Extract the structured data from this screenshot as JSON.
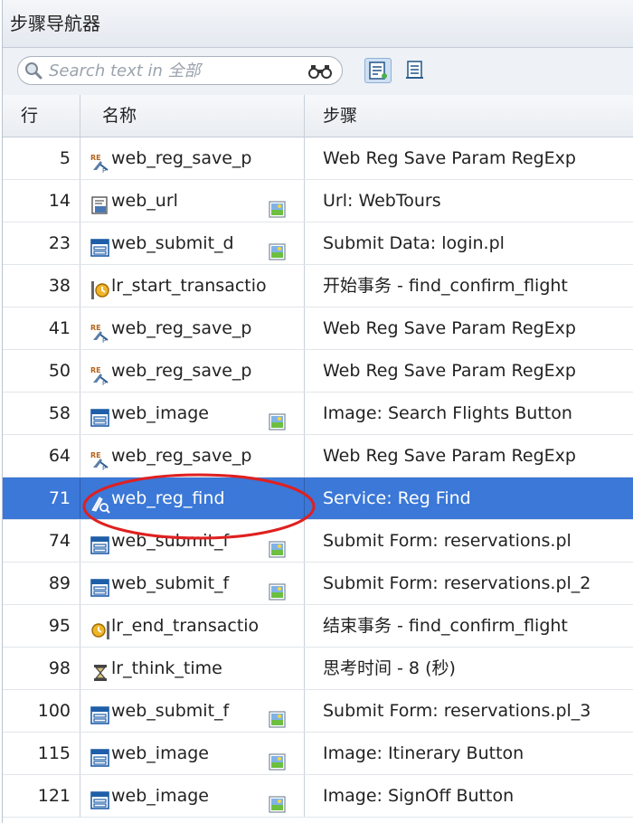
{
  "panel": {
    "title": "步骤导航器"
  },
  "search": {
    "placeholder": "Search text in 全部"
  },
  "toolbar": {
    "icons": [
      "binoculars-icon",
      "step-view-icon",
      "list-view-icon"
    ]
  },
  "columns": {
    "line": "行",
    "name": "名称",
    "step": "步骤"
  },
  "colors": {
    "selected_row": "#3b78d8",
    "highlight_ellipse": "#e02020"
  },
  "rows": [
    {
      "line": "5",
      "name": "web_reg_save_p",
      "step": "Web Reg Save Param RegExp",
      "icon": "reg-save-icon",
      "resource": false
    },
    {
      "line": "14",
      "name": "web_url",
      "step": "Url: WebTours",
      "icon": "url-icon",
      "resource": true
    },
    {
      "line": "23",
      "name": "web_submit_d",
      "step": "Submit Data: login.pl",
      "icon": "form-icon",
      "resource": true
    },
    {
      "line": "38",
      "name": "lr_start_transactio",
      "step": "开始事务 - find_confirm_flight",
      "icon": "start-transaction-icon",
      "resource": false
    },
    {
      "line": "41",
      "name": "web_reg_save_p",
      "step": "Web Reg Save Param RegExp",
      "icon": "reg-save-icon",
      "resource": false
    },
    {
      "line": "50",
      "name": "web_reg_save_p",
      "step": "Web Reg Save Param RegExp",
      "icon": "reg-save-icon",
      "resource": false
    },
    {
      "line": "58",
      "name": "web_image",
      "step": "Image: Search Flights Button",
      "icon": "form-icon",
      "resource": true
    },
    {
      "line": "64",
      "name": "web_reg_save_p",
      "step": "Web Reg Save Param RegExp",
      "icon": "reg-save-icon",
      "resource": false
    },
    {
      "line": "71",
      "name": "web_reg_find",
      "step": "Service: Reg Find",
      "icon": "reg-find-icon",
      "resource": false,
      "selected": true
    },
    {
      "line": "74",
      "name": "web_submit_f",
      "step": "Submit Form: reservations.pl",
      "icon": "form-icon",
      "resource": true
    },
    {
      "line": "89",
      "name": "web_submit_f",
      "step": "Submit Form: reservations.pl_2",
      "icon": "form-icon",
      "resource": true
    },
    {
      "line": "95",
      "name": "lr_end_transactio",
      "step": "结束事务 - find_confirm_flight",
      "icon": "end-transaction-icon",
      "resource": false
    },
    {
      "line": "98",
      "name": "lr_think_time",
      "step": "思考时间 - 8 (秒)",
      "icon": "hourglass-icon",
      "resource": false
    },
    {
      "line": "100",
      "name": "web_submit_f",
      "step": "Submit Form: reservations.pl_3",
      "icon": "form-icon",
      "resource": true
    },
    {
      "line": "115",
      "name": "web_image",
      "step": "Image: Itinerary Button",
      "icon": "form-icon",
      "resource": true
    },
    {
      "line": "121",
      "name": "web_image",
      "step": "Image: SignOff Button",
      "icon": "form-icon",
      "resource": true
    }
  ]
}
